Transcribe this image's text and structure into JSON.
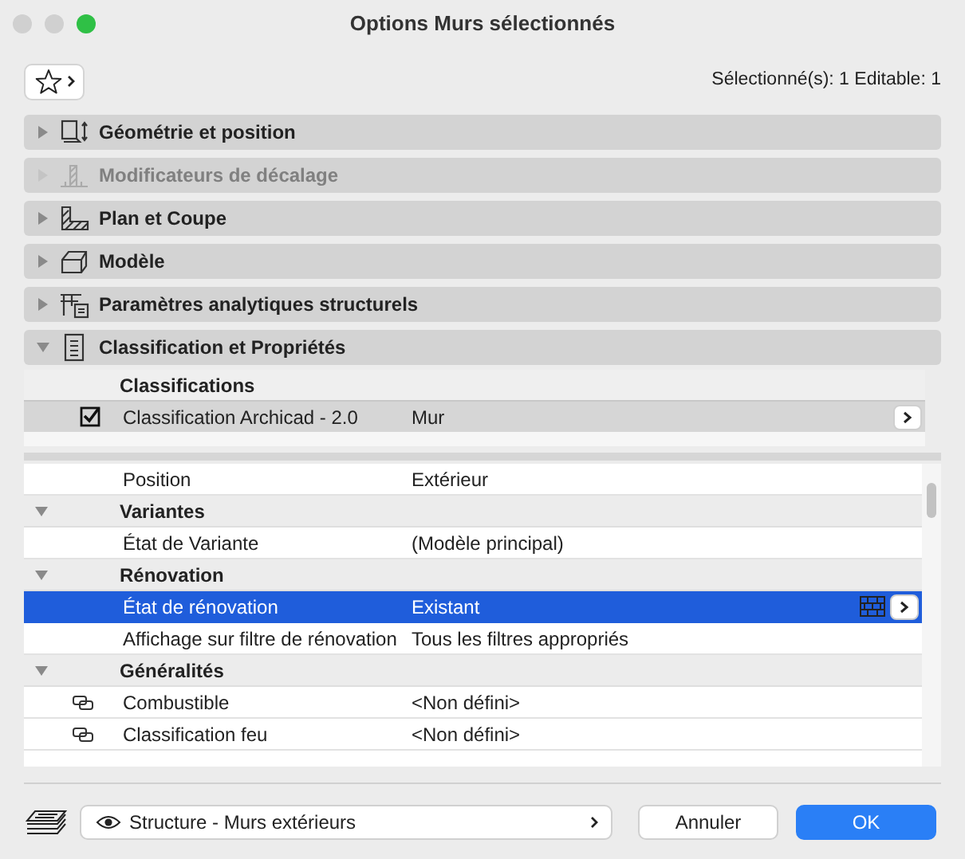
{
  "window": {
    "title": "Options Murs sélectionnés"
  },
  "selection_info": "Sélectionné(s): 1 Editable: 1",
  "panels": [
    {
      "label": "Géométrie et position",
      "expanded": false,
      "disabled": false
    },
    {
      "label": "Modificateurs de décalage",
      "expanded": false,
      "disabled": true
    },
    {
      "label": "Plan et Coupe",
      "expanded": false,
      "disabled": false
    },
    {
      "label": "Modèle",
      "expanded": false,
      "disabled": false
    },
    {
      "label": "Paramètres analytiques structurels",
      "expanded": false,
      "disabled": false
    },
    {
      "label": "Classification et Propriétés",
      "expanded": true,
      "disabled": false
    }
  ],
  "classifications": {
    "header": "Classifications",
    "rows": [
      {
        "checked": true,
        "name": "Classification Archicad - 2.0",
        "value": "Mur"
      }
    ]
  },
  "properties": [
    {
      "kind": "property",
      "label": "Position",
      "value": "Extérieur",
      "selected": false,
      "linked": false
    },
    {
      "kind": "group",
      "label": "Variantes",
      "expanded": true
    },
    {
      "kind": "property",
      "label": "État de Variante",
      "value": "(Modèle principal)",
      "selected": false,
      "linked": false
    },
    {
      "kind": "group",
      "label": "Rénovation",
      "expanded": true
    },
    {
      "kind": "property",
      "label": "État de rénovation",
      "value": "Existant",
      "selected": true,
      "linked": false
    },
    {
      "kind": "property",
      "label": "Affichage sur filtre de rénovation",
      "value": "Tous les filtres appropriés",
      "selected": false,
      "linked": false
    },
    {
      "kind": "group",
      "label": "Généralités",
      "expanded": true
    },
    {
      "kind": "property",
      "label": "Combustible",
      "value": "<Non défini>",
      "selected": false,
      "linked": true
    },
    {
      "kind": "property",
      "label": "Classification feu",
      "value": "<Non défini>",
      "selected": false,
      "linked": true
    }
  ],
  "footer": {
    "layer": "Structure - Murs extérieurs",
    "cancel": "Annuler",
    "ok": "OK"
  }
}
